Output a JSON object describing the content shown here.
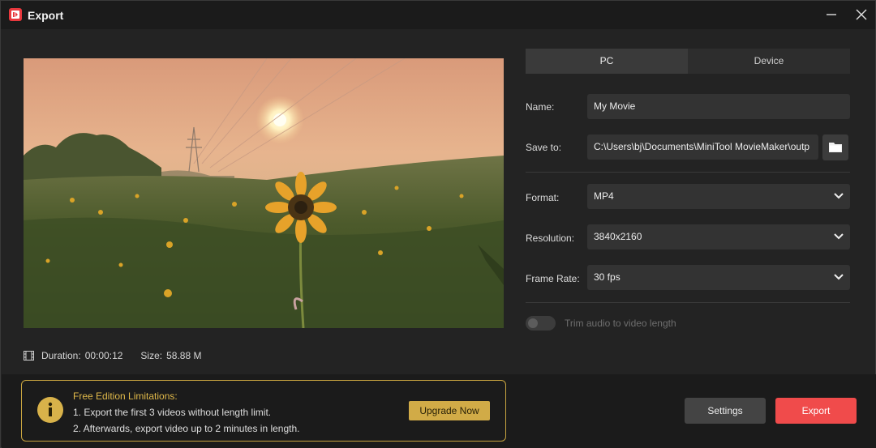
{
  "window": {
    "title": "Export"
  },
  "preview": {
    "duration_label": "Duration:",
    "duration_value": "00:00:12",
    "size_label": "Size:",
    "size_value": "58.88 M"
  },
  "tabs": [
    {
      "label": "PC",
      "active": true
    },
    {
      "label": "Device",
      "active": false
    }
  ],
  "form": {
    "name_label": "Name:",
    "name_value": "My Movie",
    "save_label": "Save to:",
    "save_value": "C:\\Users\\bj\\Documents\\MiniTool MovieMaker\\outp",
    "format_label": "Format:",
    "format_value": "MP4",
    "resolution_label": "Resolution:",
    "resolution_value": "3840x2160",
    "framerate_label": "Frame Rate:",
    "framerate_value": "30 fps",
    "trim_label": "Trim audio to video length",
    "trim_enabled": false
  },
  "limitations": {
    "title": "Free Edition Limitations:",
    "line1": "1. Export the first 3 videos without length limit.",
    "line2": "2. Afterwards, export video up to 2 minutes in length.",
    "upgrade_label": "Upgrade Now"
  },
  "buttons": {
    "settings": "Settings",
    "export": "Export"
  },
  "colors": {
    "accent_export": "#f04b4b",
    "accent_gold": "#d1ab47",
    "background": "#232323"
  },
  "icons": [
    "app-logo",
    "minimize-icon",
    "close-icon",
    "film-icon",
    "folder-icon",
    "chevron-down-icon",
    "info-icon"
  ]
}
